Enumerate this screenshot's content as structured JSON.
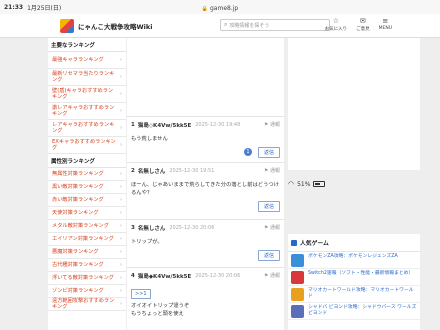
{
  "status": {
    "time": "21:33",
    "date": "1月25日(日)",
    "battery": "51%"
  },
  "url": "game8.jp",
  "header": {
    "site_title": "にゃんこ大戦争攻略Wiki",
    "search_placeholder": "攻略情報を探そう",
    "icons": [
      {
        "label": "お気に入り",
        "icon": "star-icon"
      },
      {
        "label": "ご意見",
        "icon": "mail-icon"
      },
      {
        "label": "MENU",
        "icon": "menu-icon"
      }
    ]
  },
  "sidebar": {
    "head1": "主要なランキング",
    "items1": [
      "最強キャラランキング",
      "最新リセマラ当たりランキング",
      "壁(盾)キャラおすすめランキング",
      "激レアキャラおすすめランキング",
      "レアキャラおすすめランキング",
      "EXキャラおすすめランキング"
    ],
    "head2": "属性別ランキング",
    "items2": [
      "無属性対策ランキング",
      "黒い敵対策ランキング",
      "赤い敵対策ランキング",
      "天使対策ランキング",
      "メタル敵対策ランキング",
      "エイリアン対策ランキング",
      "悪魔対策ランキング",
      "古代種対策ランキング",
      "浮いてる敵対策ランキング",
      "ゾンビ対策ランキング",
      "遠方範囲攻撃おすすめランキング"
    ]
  },
  "comments": [
    {
      "num": "1",
      "name": "猫島◇K4Vw/5kk5E",
      "date": "2025-12-30 19:48",
      "report": "通報",
      "body": "もう荒しません",
      "badge": "1",
      "reply": "返信"
    },
    {
      "num": "2",
      "name": "名無しさん",
      "date": "2025-12-30 19:51",
      "report": "通報",
      "body": "ほーん、じゃあいままで荒らしてきた分の落とし前はどうつけるんや？",
      "reply": "返信"
    },
    {
      "num": "3",
      "name": "名無しさん",
      "date": "2025-12-30 20:06",
      "report": "通報",
      "body": "トリップが。",
      "reply": "返信"
    },
    {
      "num": "4",
      "name": "猫島◆K4Vw/5kk5E",
      "date": "2025-12-30 20:06",
      "report": "通報",
      "anchor": ">>1",
      "body": "オイオイトリップ違うぞ\nもうちょっと頭を使え"
    }
  ],
  "games": {
    "title": "人気ゲーム",
    "items": [
      {
        "title": "ポケモンZA攻略：ポケモンレジェンズZA",
        "color": "#3a8fd8"
      },
      {
        "title": "Switch2速報（ソフト・性能・最新情報まとめ）",
        "color": "#d8383a"
      },
      {
        "title": "マリオカートワールド攻略：マリオカートワールド",
        "color": "#e8a020"
      },
      {
        "title": "シャドバ ビヨンド攻略：シャドウバース ワールズ ビヨンド",
        "color": "#5a6fb8"
      }
    ]
  }
}
